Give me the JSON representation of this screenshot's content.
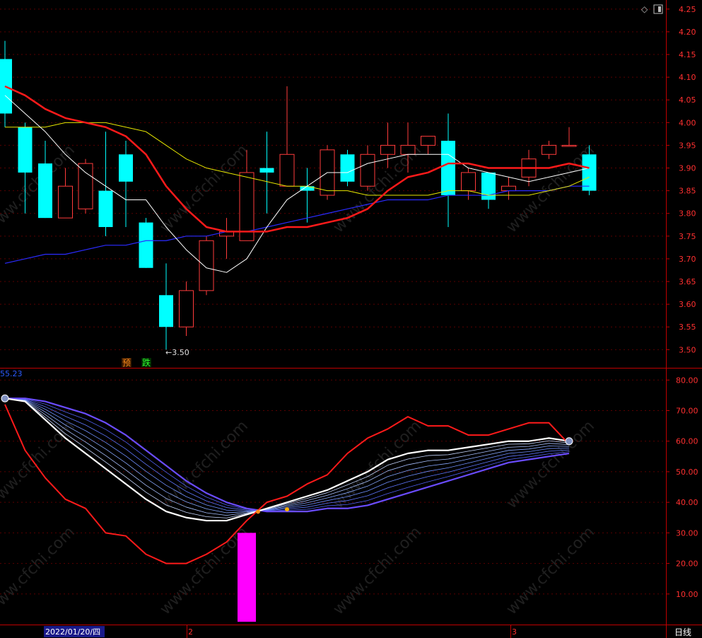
{
  "colors": {
    "background": "#000000",
    "axis": "#c00000",
    "axis_text": "#ff3030",
    "up_candle": "#ff3b3b",
    "down_candle": "#00ffff",
    "ma_white": "#ffffff",
    "ma_yellow": "#e6e600",
    "ma_red": "#ff1a1a",
    "ma_blue": "#2b2bff",
    "osc_red": "#ff1a1a",
    "osc_white": "#ffffff",
    "osc_purple": "#6a4cff",
    "bar_magenta": "#ff00ff"
  },
  "header": {
    "diamond_icon": "diamond-icon",
    "panel_toggle_icon": "panel-toggle-icon"
  },
  "watermark": "www.cfchi.com",
  "markers": {
    "low_label": "←3.50",
    "pre_label": "预",
    "fall_label": "跌",
    "lower_value": "55.23"
  },
  "footer": {
    "date_label": "2022/01/20/四",
    "month_2": "2",
    "month_3": "3",
    "period_label": "日线"
  },
  "chart_data": [
    {
      "type": "candlestick",
      "y_ticks": [
        "4.25",
        "4.20",
        "4.15",
        "4.10",
        "4.05",
        "4.00",
        "3.95",
        "3.90",
        "3.85",
        "3.80",
        "3.75",
        "3.70",
        "3.65",
        "3.60",
        "3.55",
        "3.50"
      ],
      "ylim": [
        3.46,
        4.27
      ],
      "candles": [
        {
          "o": 4.02,
          "c": 4.14,
          "h": 4.18,
          "l": 3.99,
          "up": false
        },
        {
          "o": 3.99,
          "c": 3.89,
          "h": 4.0,
          "l": 3.8,
          "up": false
        },
        {
          "o": 3.91,
          "c": 3.79,
          "h": 3.96,
          "l": 3.79,
          "up": false
        },
        {
          "o": 3.79,
          "c": 3.86,
          "h": 3.9,
          "l": 3.79,
          "up": true
        },
        {
          "o": 3.81,
          "c": 3.91,
          "h": 3.92,
          "l": 3.8,
          "up": true
        },
        {
          "o": 3.85,
          "c": 3.77,
          "h": 3.98,
          "l": 3.75,
          "up": false
        },
        {
          "o": 3.93,
          "c": 3.87,
          "h": 3.96,
          "l": 3.77,
          "up": false
        },
        {
          "o": 3.78,
          "c": 3.68,
          "h": 3.79,
          "l": 3.68,
          "up": false
        },
        {
          "o": 3.62,
          "c": 3.55,
          "h": 3.69,
          "l": 3.5,
          "up": false
        },
        {
          "o": 3.55,
          "c": 3.63,
          "h": 3.65,
          "l": 3.53,
          "up": true
        },
        {
          "o": 3.63,
          "c": 3.74,
          "h": 3.75,
          "l": 3.62,
          "up": true
        },
        {
          "o": 3.75,
          "c": 3.76,
          "h": 3.79,
          "l": 3.7,
          "up": true
        },
        {
          "o": 3.74,
          "c": 3.89,
          "h": 3.94,
          "l": 3.74,
          "up": true
        },
        {
          "o": 3.9,
          "c": 3.89,
          "h": 3.98,
          "l": 3.8,
          "up": false
        },
        {
          "o": 3.86,
          "c": 3.93,
          "h": 4.08,
          "l": 3.86,
          "up": true
        },
        {
          "o": 3.86,
          "c": 3.85,
          "h": 3.9,
          "l": 3.78,
          "up": false
        },
        {
          "o": 3.84,
          "c": 3.94,
          "h": 3.95,
          "l": 3.83,
          "up": true
        },
        {
          "o": 3.93,
          "c": 3.87,
          "h": 3.94,
          "l": 3.86,
          "up": false
        },
        {
          "o": 3.86,
          "c": 3.93,
          "h": 3.95,
          "l": 3.85,
          "up": true
        },
        {
          "o": 3.93,
          "c": 3.95,
          "h": 4.0,
          "l": 3.9,
          "up": true
        },
        {
          "o": 3.93,
          "c": 3.95,
          "h": 4.0,
          "l": 3.89,
          "up": true
        },
        {
          "o": 3.95,
          "c": 3.97,
          "h": 3.97,
          "l": 3.93,
          "up": true
        },
        {
          "o": 3.96,
          "c": 3.84,
          "h": 4.02,
          "l": 3.77,
          "up": false
        },
        {
          "o": 3.85,
          "c": 3.89,
          "h": 3.9,
          "l": 3.83,
          "up": true
        },
        {
          "o": 3.89,
          "c": 3.83,
          "h": 3.89,
          "l": 3.81,
          "up": false
        },
        {
          "o": 3.85,
          "c": 3.86,
          "h": 3.88,
          "l": 3.83,
          "up": true
        },
        {
          "o": 3.88,
          "c": 3.92,
          "h": 3.94,
          "l": 3.86,
          "up": true
        },
        {
          "o": 3.93,
          "c": 3.95,
          "h": 3.96,
          "l": 3.92,
          "up": true
        },
        {
          "o": 3.95,
          "c": 3.95,
          "h": 3.99,
          "l": 3.95,
          "up": true
        },
        {
          "o": 3.93,
          "c": 3.85,
          "h": 3.95,
          "l": 3.84,
          "up": false
        }
      ],
      "ma_white": [
        4.06,
        4.02,
        3.98,
        3.93,
        3.89,
        3.86,
        3.83,
        3.83,
        3.77,
        3.72,
        3.68,
        3.67,
        3.7,
        3.77,
        3.83,
        3.86,
        3.89,
        3.89,
        3.91,
        3.92,
        3.93,
        3.93,
        3.93,
        3.9,
        3.89,
        3.88,
        3.87,
        3.88,
        3.89,
        3.9
      ],
      "ma_yellow": [
        3.99,
        3.99,
        3.99,
        4.0,
        4.0,
        4.0,
        3.99,
        3.98,
        3.95,
        3.92,
        3.9,
        3.89,
        3.88,
        3.87,
        3.86,
        3.86,
        3.85,
        3.85,
        3.84,
        3.84,
        3.84,
        3.84,
        3.85,
        3.85,
        3.84,
        3.84,
        3.84,
        3.85,
        3.86,
        3.88
      ],
      "ma_red": [
        4.08,
        4.06,
        4.03,
        4.01,
        4.0,
        3.99,
        3.97,
        3.93,
        3.86,
        3.81,
        3.77,
        3.76,
        3.76,
        3.76,
        3.77,
        3.77,
        3.78,
        3.79,
        3.81,
        3.85,
        3.88,
        3.89,
        3.91,
        3.91,
        3.9,
        3.9,
        3.9,
        3.9,
        3.91,
        3.9
      ],
      "ma_blue": [
        3.69,
        3.7,
        3.71,
        3.71,
        3.72,
        3.73,
        3.73,
        3.74,
        3.74,
        3.75,
        3.75,
        3.76,
        3.76,
        3.77,
        3.78,
        3.79,
        3.8,
        3.81,
        3.82,
        3.83,
        3.83,
        3.83,
        3.84,
        3.84,
        3.84,
        3.85,
        3.85,
        3.85,
        3.86,
        3.86
      ]
    },
    {
      "type": "line",
      "y_ticks": [
        "80.00",
        "70.00",
        "60.00",
        "50.00",
        "40.00",
        "30.00",
        "20.00",
        "10.00"
      ],
      "ylim": [
        0,
        84
      ],
      "red": [
        72,
        57,
        48,
        41,
        38,
        30,
        29,
        23,
        20,
        20,
        23,
        27,
        34,
        40,
        42,
        46,
        49,
        56,
        61,
        64,
        68,
        65,
        65,
        62,
        62,
        64,
        66,
        66,
        59
      ],
      "white": [
        74,
        73,
        67,
        61,
        56,
        51,
        46,
        41,
        37,
        35,
        34,
        34,
        36,
        38,
        40,
        42,
        44,
        47,
        50,
        54,
        56,
        57,
        57,
        58,
        59,
        60,
        60,
        61,
        60
      ],
      "purple": [
        74,
        74,
        73,
        71,
        69,
        66,
        62,
        57,
        52,
        47,
        43,
        40,
        38,
        37,
        37,
        37,
        38,
        38,
        39,
        41,
        43,
        45,
        47,
        49,
        51,
        53,
        54,
        55,
        56
      ],
      "bar": {
        "index": 12,
        "value": 30
      }
    }
  ]
}
